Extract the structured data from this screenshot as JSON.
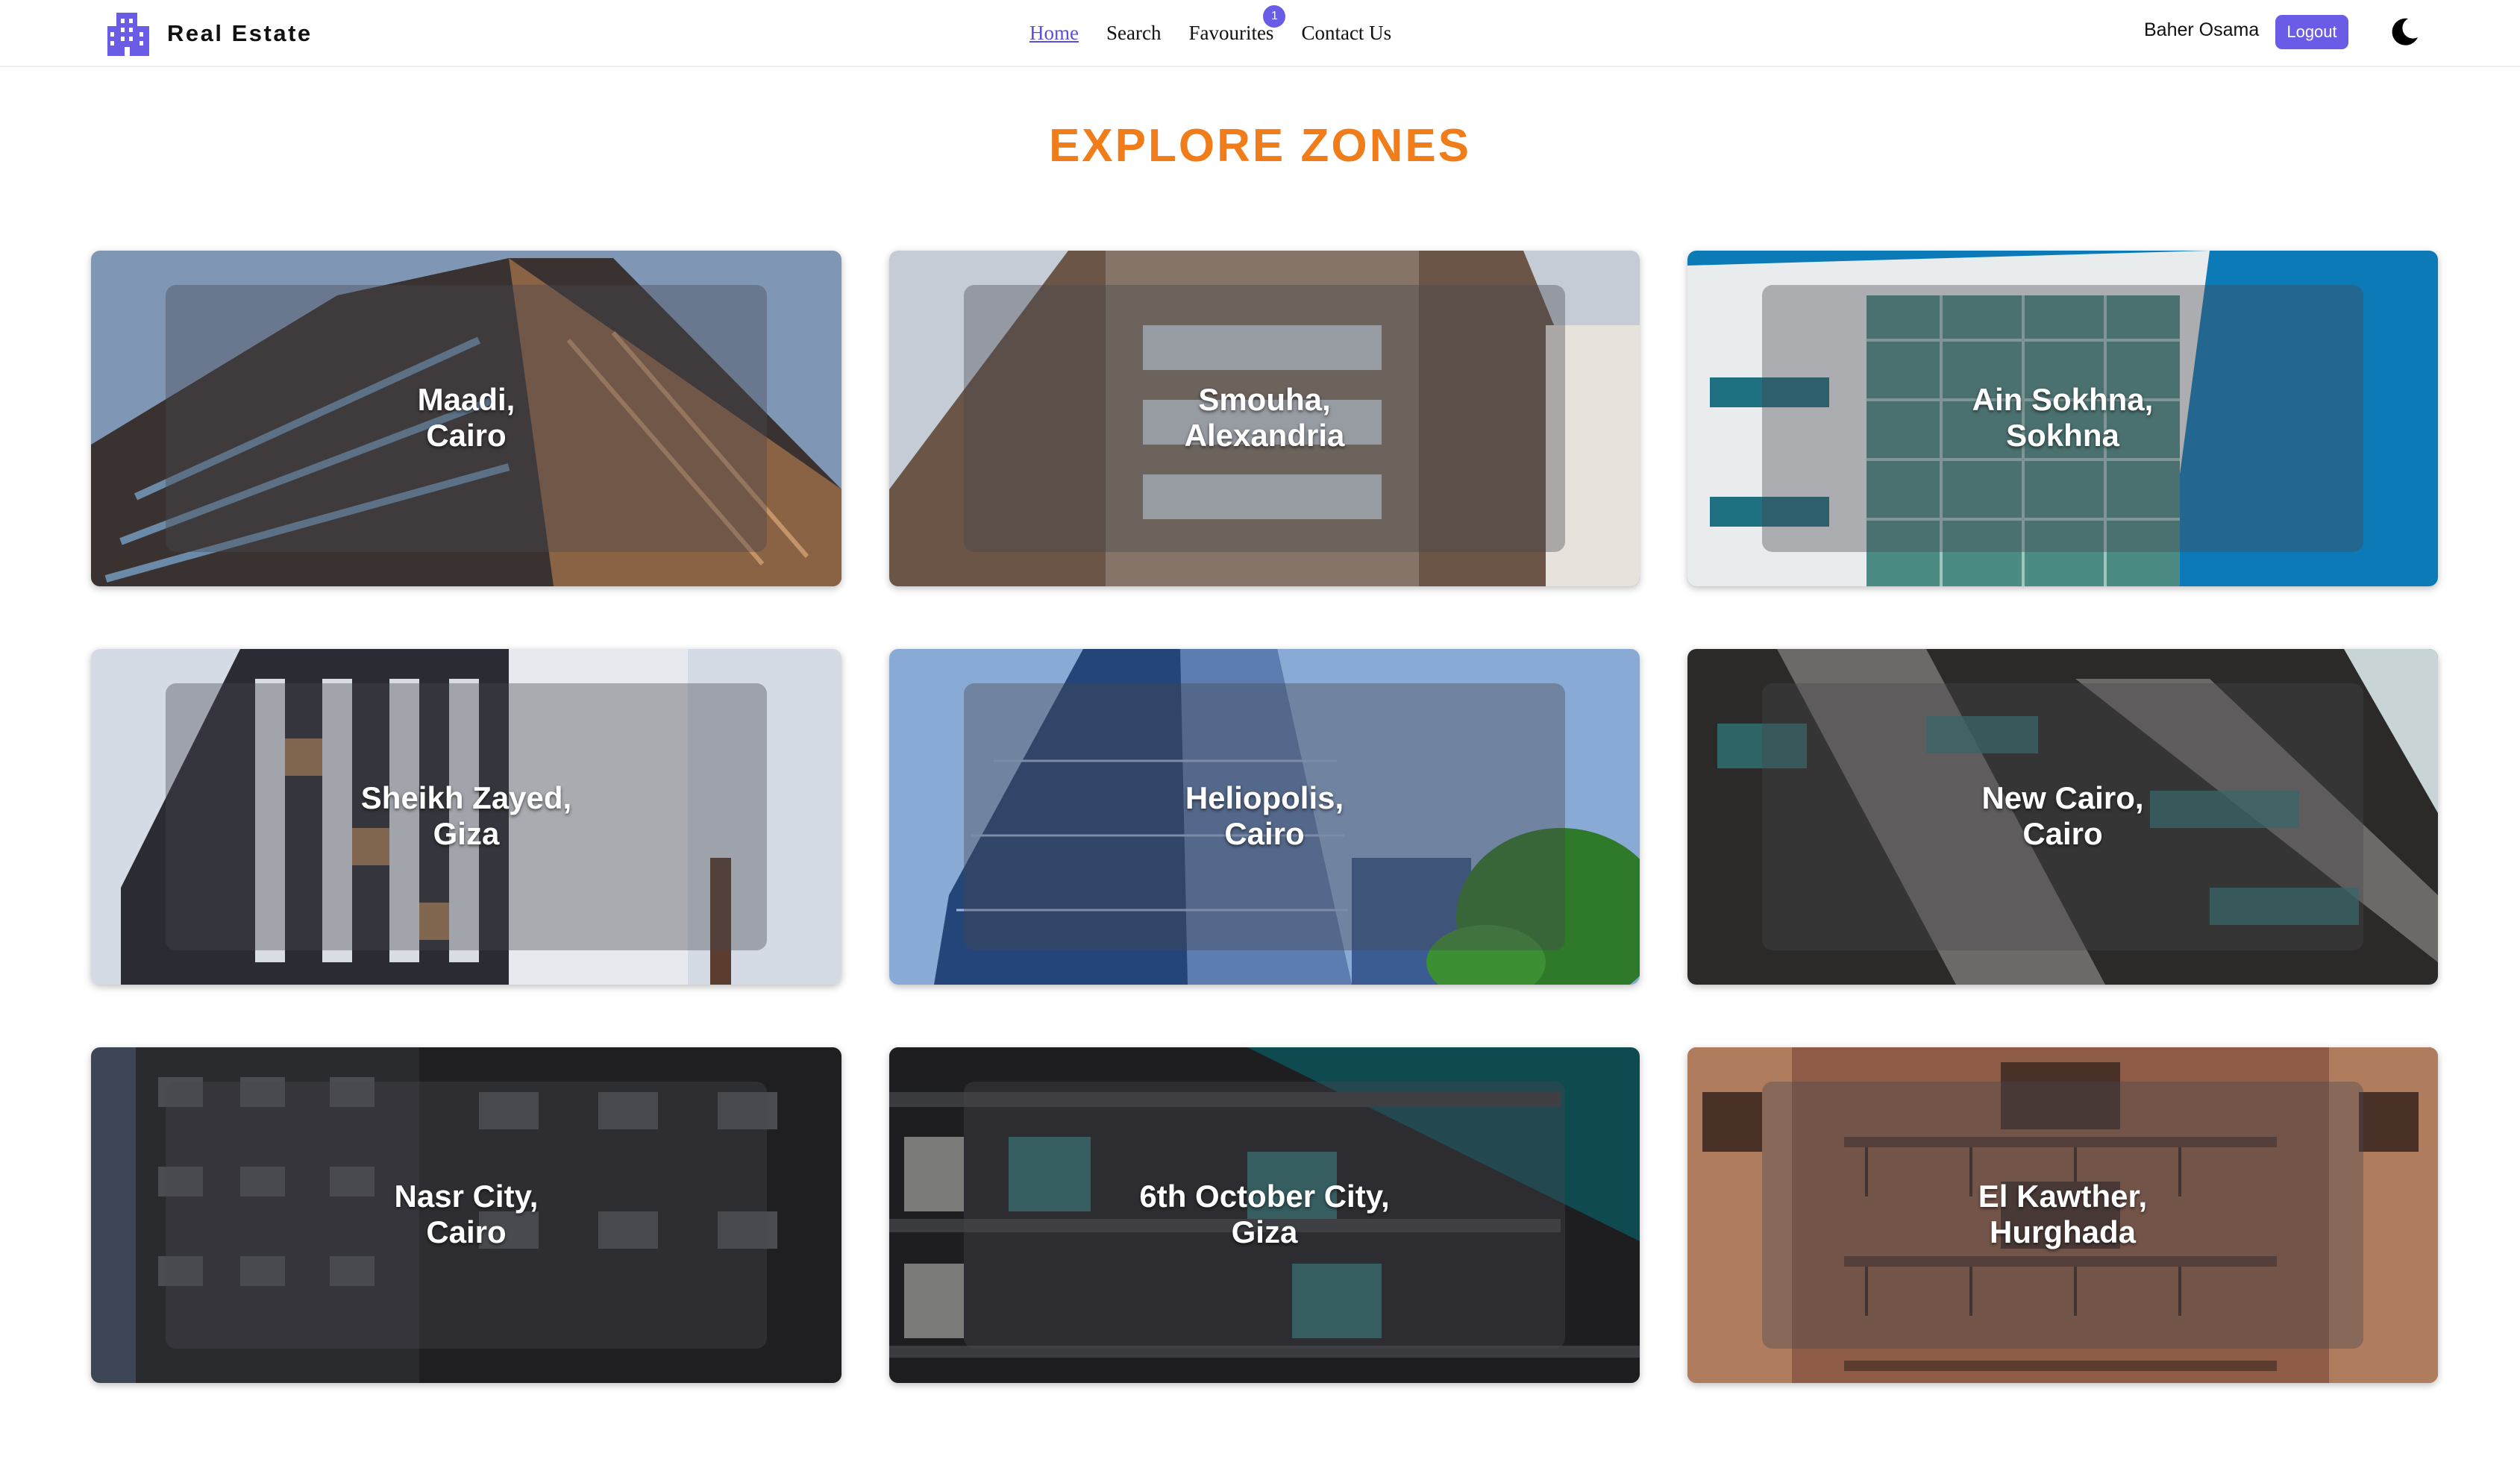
{
  "brand": {
    "name": "Real Estate",
    "icon": "building-icon",
    "color": "#6b5ce7"
  },
  "nav": {
    "links": [
      {
        "label": "Home",
        "active": true
      },
      {
        "label": "Search",
        "active": false
      },
      {
        "label": "Favourites",
        "active": false,
        "badge": "1"
      },
      {
        "label": "Contact Us",
        "active": false
      }
    ]
  },
  "user": {
    "name": "Baher Osama",
    "logout_label": "Logout",
    "theme_icon": "moon-icon"
  },
  "page": {
    "title": "EXPLORE ZONES",
    "title_color": "#f07c1a"
  },
  "zones": [
    {
      "line1": "Maadi,",
      "line2": "Cairo"
    },
    {
      "line1": "Smouha,",
      "line2": "Alexandria"
    },
    {
      "line1": "Ain Sokhna,",
      "line2": "Sokhna"
    },
    {
      "line1": "Sheikh Zayed,",
      "line2": "Giza"
    },
    {
      "line1": "Heliopolis,",
      "line2": "Cairo"
    },
    {
      "line1": "New Cairo,",
      "line2": "Cairo"
    },
    {
      "line1": "Nasr City,",
      "line2": "Cairo"
    },
    {
      "line1": "6th October City,",
      "line2": "Giza"
    },
    {
      "line1": "El Kawther,",
      "line2": "Hurghada"
    }
  ],
  "colors": {
    "accent": "#6b5ce7",
    "heading": "#f07c1a"
  }
}
